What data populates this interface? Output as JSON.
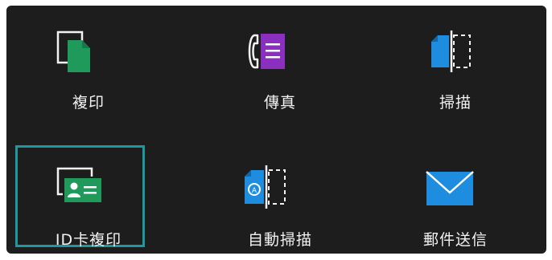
{
  "tiles": {
    "copy": {
      "label": "複印",
      "icon": "copy-icon"
    },
    "fax": {
      "label": "傳真",
      "icon": "fax-icon"
    },
    "scan": {
      "label": "掃描",
      "icon": "scan-icon"
    },
    "id_copy": {
      "label": "ID卡複印",
      "icon": "id-card-copy-icon",
      "selected": true
    },
    "auto_scan": {
      "label": "自動掃描",
      "icon": "auto-scan-icon"
    },
    "email": {
      "label": "郵件送信",
      "icon": "mail-icon"
    }
  },
  "colors": {
    "background": "#1d1d1d",
    "copy_green": "#1f9a5a",
    "fax_purple": "#8a2fc0",
    "scan_blue": "#1e8de0",
    "selection_teal": "#1a9aa0",
    "text": "#f2f2f2"
  }
}
